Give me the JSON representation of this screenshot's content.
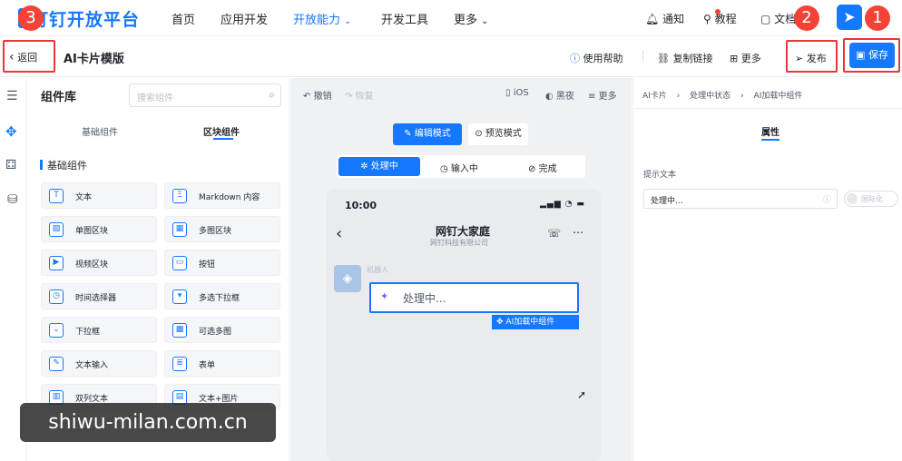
{
  "app": {
    "title": "钉钉开放平台"
  },
  "nav": {
    "items": [
      "首页",
      "应用开发",
      "开放能力",
      "开发工具",
      "更多"
    ],
    "right": [
      "通知",
      "教程",
      "文档"
    ]
  },
  "badges": {
    "one": "1",
    "two": "2",
    "three": "3"
  },
  "toolbar": {
    "back": "返回",
    "page_title": "AI卡片模版",
    "help": "使用帮助",
    "copy_link": "复制链接",
    "more": "更多",
    "publish": "发布",
    "save": "保存"
  },
  "component_panel": {
    "title": "组件库",
    "search_placeholder": "搜索组件",
    "tabs": [
      "基础组件",
      "区块组件"
    ],
    "section": "基础组件",
    "items": [
      {
        "label": "文本",
        "icon": "text-icon"
      },
      {
        "label": "Markdown 内容",
        "icon": "markdown-icon"
      },
      {
        "label": "单图区块",
        "icon": "image-icon"
      },
      {
        "label": "多图区块",
        "icon": "images-icon"
      },
      {
        "label": "视频区块",
        "icon": "video-icon"
      },
      {
        "label": "按钮",
        "icon": "button-icon"
      },
      {
        "label": "时间选择器",
        "icon": "clock-icon"
      },
      {
        "label": "多选下拉框",
        "icon": "multi-select-icon"
      },
      {
        "label": "下拉框",
        "icon": "dropdown-icon"
      },
      {
        "label": "可选多图",
        "icon": "selectable-images-icon"
      },
      {
        "label": "文本输入",
        "icon": "edit-icon"
      },
      {
        "label": "表单",
        "icon": "form-icon"
      },
      {
        "label": "双列文本",
        "icon": "two-column-icon"
      },
      {
        "label": "文本+图片",
        "icon": "text-image-icon"
      }
    ]
  },
  "canvas": {
    "undo": "撤销",
    "redo": "恢复",
    "platform": "iOS",
    "dark": "黑夜",
    "more": "更多",
    "mode_edit": "编辑模式",
    "mode_preview": "预览模式",
    "states": [
      "处理中",
      "输入中",
      "完成"
    ],
    "phone": {
      "time": "10:00",
      "chat_title": "网钉大家庭",
      "chat_subtitle": "网钉科技有限公司",
      "sender": "机器人",
      "input_text": "处理中...",
      "component_tag": "AI加载中组件"
    }
  },
  "right_panel": {
    "breadcrumb": [
      "AI卡片",
      "处理中状态",
      "AI加载中组件"
    ],
    "tab": "属性",
    "field_label": "提示文本",
    "field_value": "处理中...",
    "i18n_label": "国际化"
  },
  "watermark": "shiwu-milan.com.cn",
  "colors": {
    "accent": "#1677ff",
    "highlight": "#e53935"
  }
}
